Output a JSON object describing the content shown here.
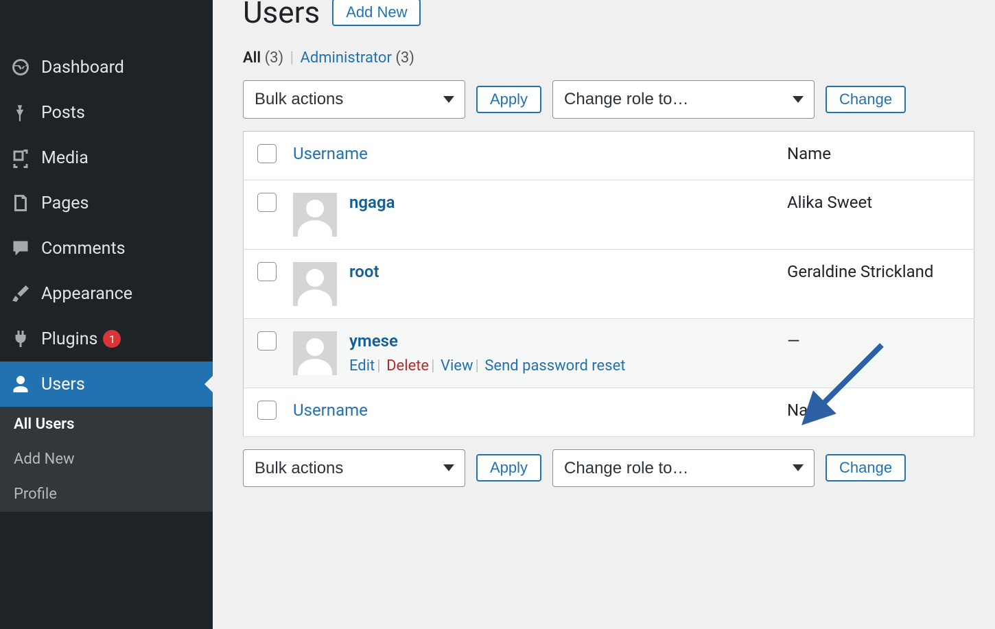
{
  "sidebar": {
    "items": [
      {
        "label": "Dashboard",
        "icon": "dashboard"
      },
      {
        "label": "Posts",
        "icon": "pin"
      },
      {
        "label": "Media",
        "icon": "media"
      },
      {
        "label": "Pages",
        "icon": "pages"
      },
      {
        "label": "Comments",
        "icon": "comment"
      },
      {
        "label": "Appearance",
        "icon": "brush"
      },
      {
        "label": "Plugins",
        "icon": "plug",
        "badge": "1"
      },
      {
        "label": "Users",
        "icon": "user",
        "active": true
      }
    ],
    "subitems": [
      {
        "label": "All Users",
        "current": true
      },
      {
        "label": "Add New"
      },
      {
        "label": "Profile"
      }
    ]
  },
  "header": {
    "title": "Users",
    "add_new": "Add New"
  },
  "filters": {
    "all_label": "All",
    "all_count": "(3)",
    "admin_label": "Administrator",
    "admin_count": "(3)"
  },
  "controls": {
    "bulk_placeholder": "Bulk actions",
    "apply_label": "Apply",
    "role_placeholder": "Change role to…",
    "change_label": "Change"
  },
  "table": {
    "col_username": "Username",
    "col_name": "Name",
    "rows": [
      {
        "username": "ngaga",
        "name": "Alika Sweet"
      },
      {
        "username": "root",
        "name": "Geraldine Strickland"
      },
      {
        "username": "ymese",
        "name": "—",
        "show_actions": true
      }
    ],
    "actions": {
      "edit": "Edit",
      "delete": "Delete",
      "view": "View",
      "reset": "Send password reset"
    }
  }
}
